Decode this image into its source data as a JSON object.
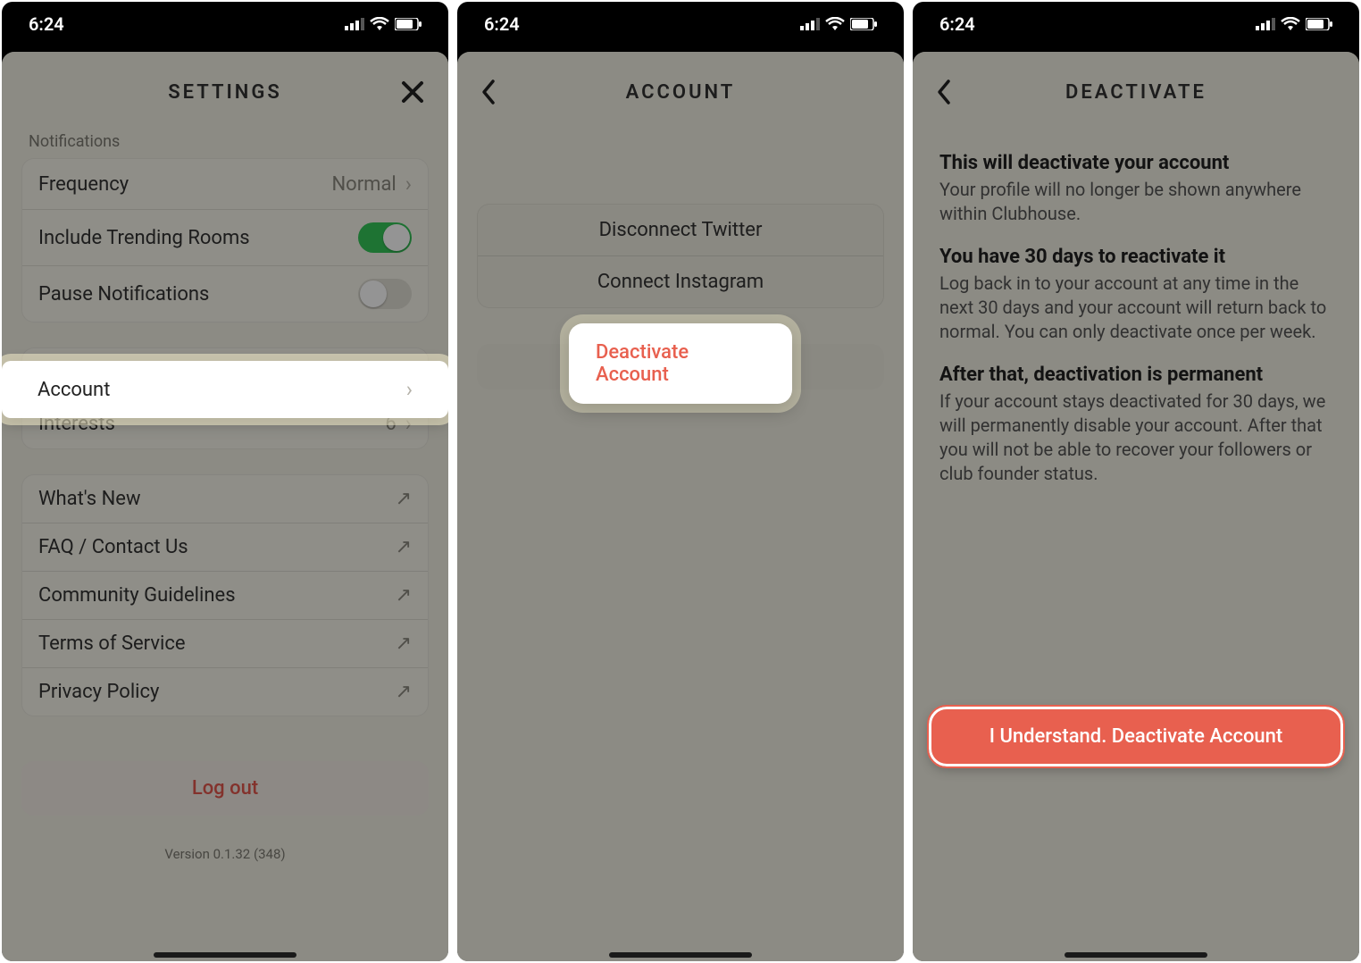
{
  "status": {
    "time": "6:24"
  },
  "screen1": {
    "title": "SETTINGS",
    "notifications_label": "Notifications",
    "frequency_label": "Frequency",
    "frequency_value": "Normal",
    "trending_label": "Include Trending Rooms",
    "trending_on": true,
    "pause_label": "Pause Notifications",
    "pause_on": false,
    "account_label": "Account",
    "interests_label": "Interests",
    "interests_value": "6",
    "links": {
      "whats_new": "What's New",
      "faq": "FAQ / Contact Us",
      "community": "Community Guidelines",
      "terms": "Terms of Service",
      "privacy": "Privacy Policy"
    },
    "logout": "Log out",
    "version": "Version 0.1.32 (348)"
  },
  "screen2": {
    "title": "ACCOUNT",
    "disconnect_twitter": "Disconnect Twitter",
    "connect_instagram": "Connect Instagram",
    "deactivate": "Deactivate Account"
  },
  "screen3": {
    "title": "DEACTIVATE",
    "h1": "This will deactivate your account",
    "p1": "Your profile will no longer be shown anywhere within Clubhouse.",
    "h2": "You have 30 days to reactivate it",
    "p2": "Log back in to your account at any time in the next 30 days and your account will return back to normal. You can only deactivate once per week.",
    "h3": "After that, deactivation is permanent",
    "p3": "If your account stays deactivated for 30 days, we will permanently disable your account. After that you will not be able to recover your followers or club founder status.",
    "confirm": "I Understand. Deactivate Account"
  }
}
